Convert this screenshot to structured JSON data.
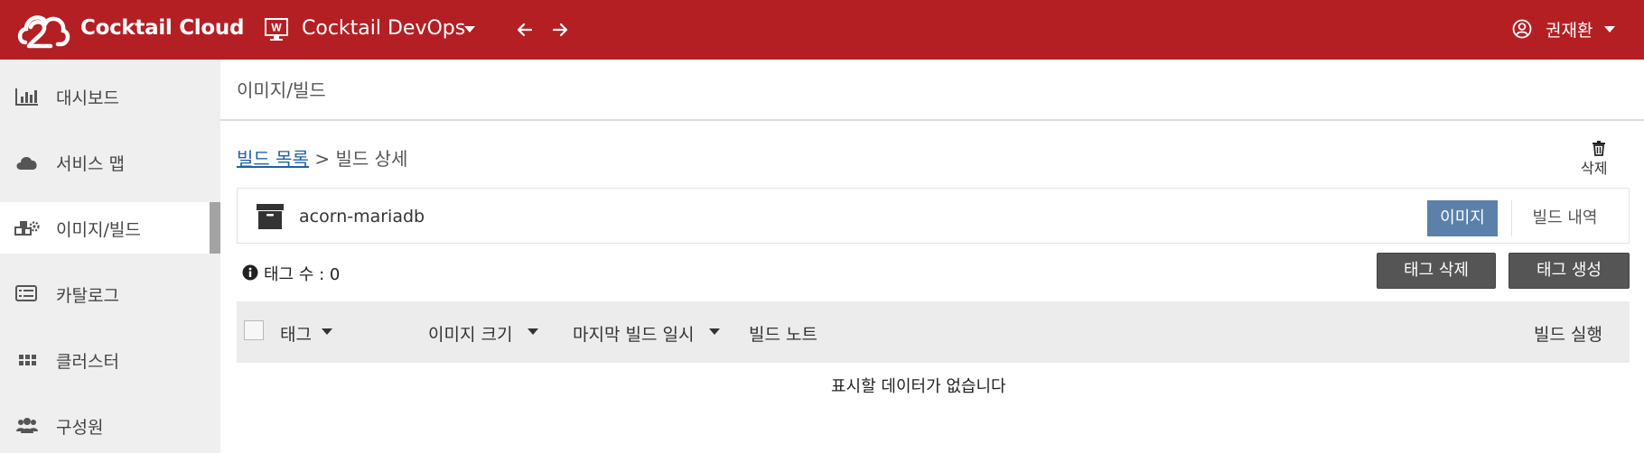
{
  "topbar": {
    "brand": "Cocktail Cloud",
    "workspace_icon_letter": "W",
    "workspace": "Cocktail DevOps",
    "user": "권재환",
    "color": "#b41f24"
  },
  "sidebar": {
    "items": [
      {
        "label": "대시보드",
        "icon": "bar-chart-icon"
      },
      {
        "label": "서비스 맵",
        "icon": "cloud-icon"
      },
      {
        "label": "이미지/빌드",
        "icon": "cubes-gear-icon",
        "active": true
      },
      {
        "label": "카탈로그",
        "icon": "list-card-icon"
      },
      {
        "label": "클러스터",
        "icon": "grid-icon"
      },
      {
        "label": "구성원",
        "icon": "users-icon"
      }
    ]
  },
  "main": {
    "page_title": "이미지/빌드",
    "breadcrumb": {
      "link": "빌드 목록",
      "separator": ">",
      "current": "빌드 상세"
    },
    "delete_label": "삭제",
    "image_name": "acorn-mariadb",
    "tabs": [
      {
        "label": "이미지",
        "active": true
      },
      {
        "label": "빌드 내역",
        "active": false
      }
    ],
    "tag_count_text": "태그 수 : 0",
    "buttons": {
      "delete_tag": "태그 삭제",
      "create_tag": "태그 생성"
    },
    "table": {
      "columns": [
        "태그",
        "이미지 크기",
        "마지막 빌드 일시",
        "빌드 노트",
        "빌드 실행"
      ],
      "empty": "표시할 데이터가 없습니다"
    }
  }
}
